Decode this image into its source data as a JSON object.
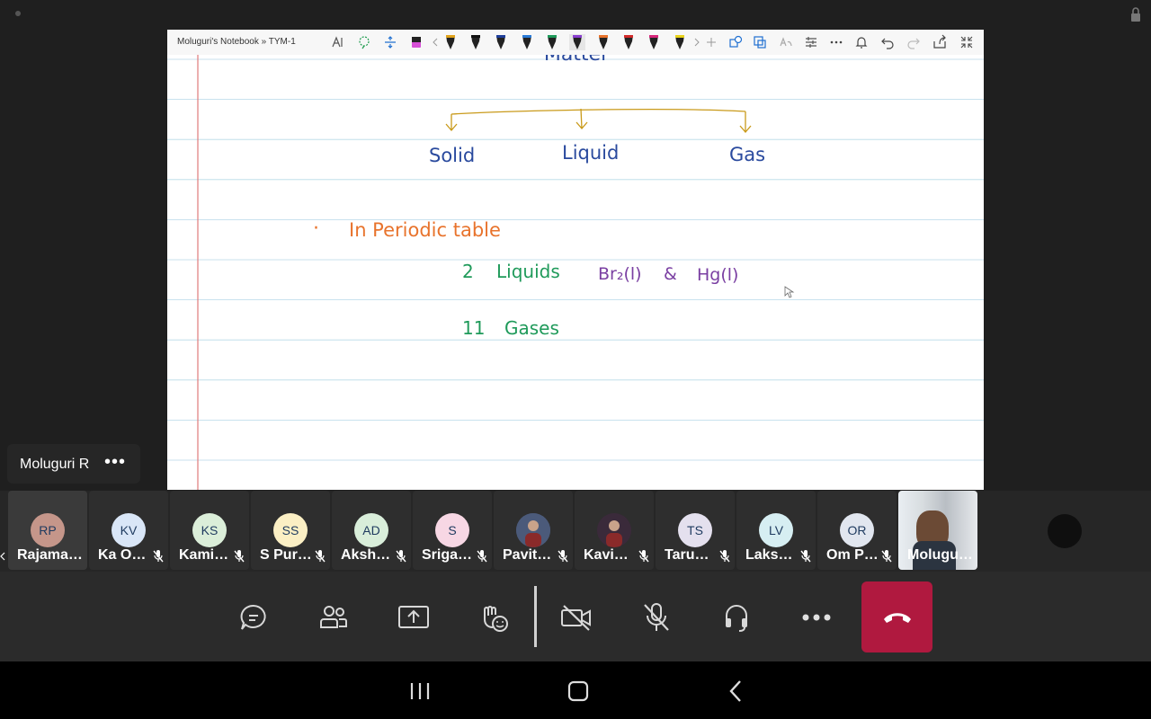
{
  "window": {
    "title": "Moluguri's Notebook » TYM-1"
  },
  "notebook": {
    "lines": {
      "matter": "Matter",
      "solid": "Solid",
      "liquid": "Liquid",
      "gas": "Gas",
      "bullet": "·",
      "periodic": "In Periodic table",
      "liquids_count": "2",
      "liquids_label": "Liquids",
      "br": "Br₂(l)",
      "amp": "&",
      "hg": "Hg(l)",
      "gases_count": "11",
      "gases_label": "Gases"
    },
    "colors": {
      "blue": "#2a4a9e",
      "gold": "#c99a1a",
      "orange": "#e8732c",
      "green": "#1f9a5a",
      "purple": "#7a3fa2",
      "margin": "#e07a7a",
      "rule": "#b7d9e8"
    }
  },
  "presenter": {
    "name": "Moluguri R",
    "more": "•••"
  },
  "participants": [
    {
      "initials": "RP",
      "name": "Rajaman...",
      "color": "#c5968a",
      "muted": false,
      "selected": true
    },
    {
      "initials": "KV",
      "name": "Ka Om...",
      "color": "#d9e6f7",
      "muted": true
    },
    {
      "initials": "KS",
      "name": "Kamini...",
      "color": "#dbeed9",
      "muted": true
    },
    {
      "initials": "SS",
      "name": "S Purv...",
      "color": "#fbefc4",
      "muted": true
    },
    {
      "initials": "AD",
      "name": "Aksha...",
      "color": "#d9eeda",
      "muted": true
    },
    {
      "initials": "S",
      "name": "Srigay...",
      "color": "#f7d7e4",
      "muted": true
    },
    {
      "initials": "",
      "name": "Pavith...",
      "color": "#4b5a7a",
      "muted": true,
      "photo": true
    },
    {
      "initials": "",
      "name": "Kavin ...",
      "color": "#3a2a3a",
      "muted": true,
      "photo": true
    },
    {
      "initials": "TS",
      "name": "Tarun ...",
      "color": "#e4e0ee",
      "muted": true
    },
    {
      "initials": "LV",
      "name": "Laksh...",
      "color": "#d6eef2",
      "muted": true
    },
    {
      "initials": "OR",
      "name": "Om Pr...",
      "color": "#e1e6ef",
      "muted": true
    },
    {
      "initials": "",
      "name": "Moluguri...",
      "color": "#8a8f96",
      "muted": false,
      "video": true
    }
  ],
  "controls": {
    "accent": "#b0193f",
    "buttons": [
      "chat-icon",
      "participants-icon",
      "share-screen-icon",
      "reactions-icon",
      "camera-off-icon",
      "mic-off-icon",
      "audio-icon",
      "more-icon",
      "hang-up-icon"
    ]
  }
}
